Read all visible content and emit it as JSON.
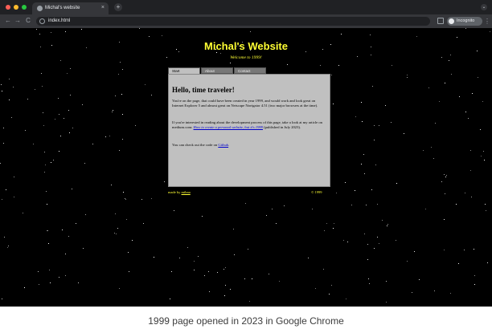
{
  "browser": {
    "tab_title": "Michal's website",
    "tab_close": "×",
    "new_tab": "+",
    "address": "index.html",
    "incognito_label": "Incognito",
    "nav_back": "←",
    "nav_forward": "→",
    "nav_reload": "C",
    "menu": "⋮",
    "tab_search": "⌄",
    "traffic_light_colors": [
      "#ff5f57",
      "#febc2e",
      "#28c840"
    ],
    "icons": [
      "back-arrow-icon",
      "forward-arrow-icon",
      "reload-icon",
      "site-info-icon",
      "side-panel-icon",
      "incognito-icon",
      "more-menu-icon",
      "tab-search-icon"
    ]
  },
  "page": {
    "title": "Michal's Website",
    "subtitle": "Welcome to 1999!",
    "tabs": [
      {
        "label": "Start",
        "active": true
      },
      {
        "label": "About",
        "active": false
      },
      {
        "label": "Contact",
        "active": false
      }
    ],
    "heading": "Hello, time traveler!",
    "p1": "You're on the page, that could have been created in year 1999, and would work and look great on Internet Explorer 5 and almost great on Netscape Navigator 4.51 (two major browsers at the time).",
    "p2_before": "If you're interested in reading about the development process of this page, take a look at my article on medium.com: ",
    "p2_link": "How to create a personal website, but it's 1999",
    "p2_after": " (published in July 2023).",
    "p3_before": "You can check out the code on ",
    "p3_link": "Github",
    "p3_after": ".",
    "footer_made_by": "made by ",
    "footer_author": "mihna",
    "footer_copyright": "© 1999",
    "colors": {
      "accent": "#ffff33",
      "panel": "#c0c0c0",
      "background": "#000000",
      "link": "#0000cc"
    }
  },
  "caption": "1999 page opened in 2023 in Google Chrome"
}
